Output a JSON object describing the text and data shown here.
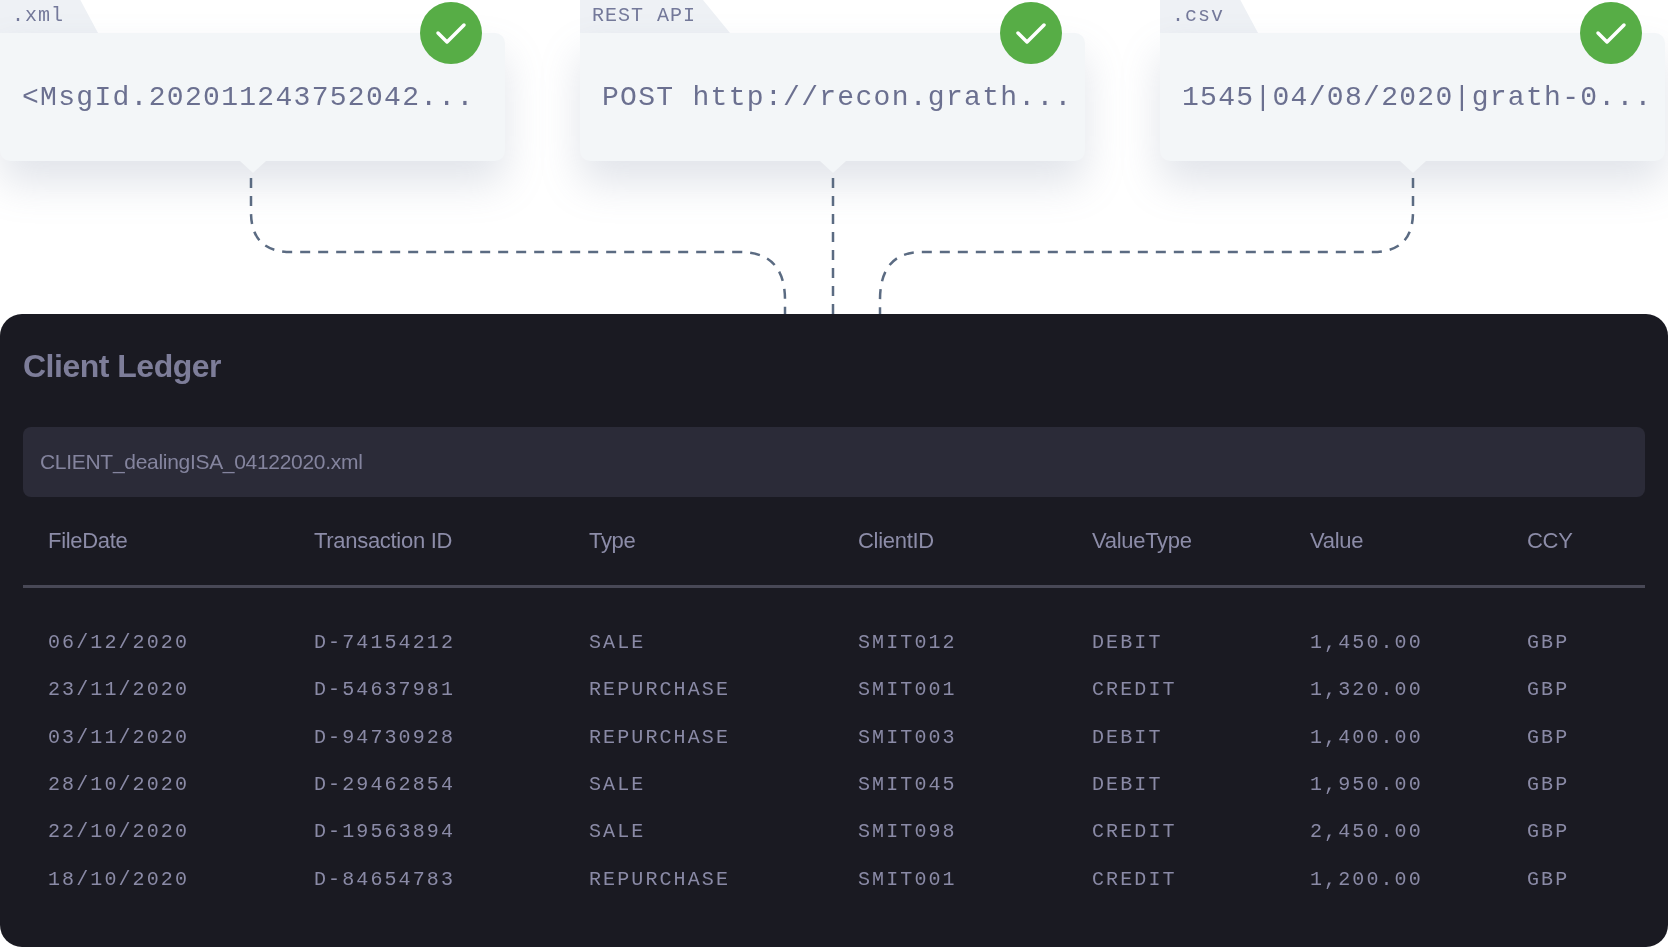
{
  "sources": [
    {
      "tab": ".xml",
      "text": "<MsgId.202011243752042...",
      "verified": true
    },
    {
      "tab": "REST API",
      "text": "POST http://recon.grath...",
      "verified": true
    },
    {
      "tab": ".csv",
      "text": "1545|04/08/2020|grath-0...",
      "verified": true
    }
  ],
  "ledger": {
    "title": "Client Ledger",
    "file_field": {
      "value": "CLIENT_dealingISA_04122020.xml"
    },
    "columns": [
      "FileDate",
      "Transaction ID",
      "Type",
      "ClientID",
      "ValueType",
      "Value",
      "CCY"
    ],
    "rows": [
      [
        "06/12/2020",
        "D-74154212",
        "SALE",
        "SMIT012",
        "DEBIT",
        "1,450.00",
        "GBP"
      ],
      [
        "23/11/2020",
        "D-54637981",
        "REPURCHASE",
        "SMIT001",
        "CREDIT",
        "1,320.00",
        "GBP"
      ],
      [
        "03/11/2020",
        "D-94730928",
        "REPURCHASE",
        "SMIT003",
        "DEBIT",
        "1,400.00",
        "GBP"
      ],
      [
        "28/10/2020",
        "D-29462854",
        "SALE",
        "SMIT045",
        "DEBIT",
        "1,950.00",
        "GBP"
      ],
      [
        "22/10/2020",
        "D-19563894",
        "SALE",
        "SMIT098",
        "CREDIT",
        "2,450.00",
        "GBP"
      ],
      [
        "18/10/2020",
        "D-84654783",
        "REPURCHASE",
        "SMIT001",
        "CREDIT",
        "1,200.00",
        "GBP"
      ]
    ]
  }
}
